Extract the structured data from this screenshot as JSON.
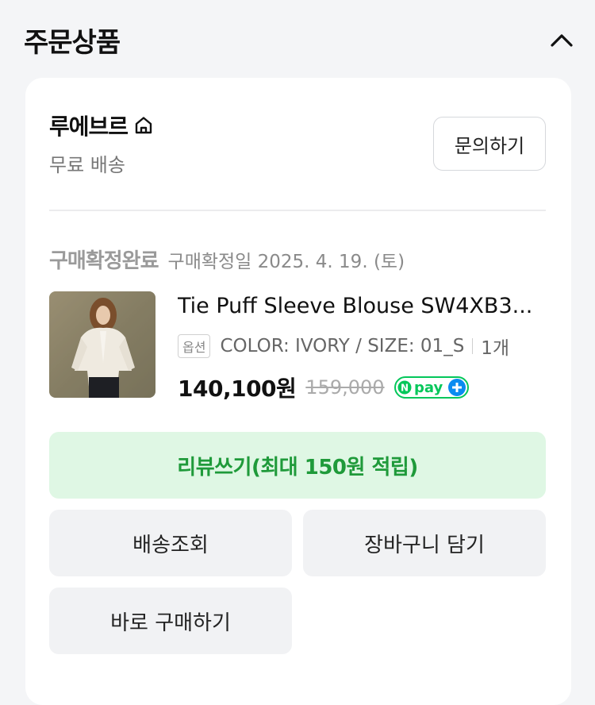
{
  "section": {
    "title": "주문상품",
    "collapse_icon": "chevron-up-icon"
  },
  "store": {
    "name": "루에브르",
    "home_icon": "home-icon",
    "shipping": "무료 배송",
    "inquiry_label": "문의하기"
  },
  "order": {
    "status": "구매확정완료",
    "confirm_date": "구매확정일 2025. 4. 19. (토)",
    "product": {
      "name": "Tie Puff Sleeve Blouse SW4XB3...",
      "option_badge": "옵션",
      "option": "COLOR: IVORY / SIZE: 01_S",
      "quantity": "1개",
      "sale_price": "140,100원",
      "original_price": "159,000",
      "npay_label": "pay"
    }
  },
  "actions": {
    "review": "리뷰쓰기(최대 150원 적립)",
    "delivery": "배송조회",
    "cart": "장바구니 담기",
    "buy_now": "바로 구매하기"
  },
  "colors": {
    "background": "#f4f5f7",
    "card": "#ffffff",
    "review_bg": "#dff7e4",
    "review_text": "#1f9a3a",
    "npay_green": "#03c75a"
  }
}
